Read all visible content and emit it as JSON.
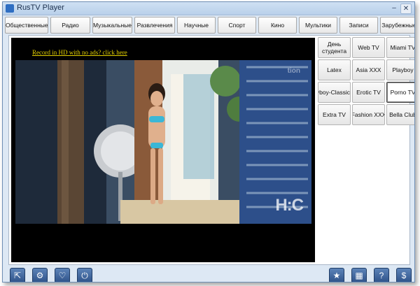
{
  "window": {
    "title": "RusTV Player",
    "close_label": "✕",
    "min_label": "–"
  },
  "tabs": [
    "Общественные",
    "Радио",
    "Музыкальные",
    "Развлечения",
    "Научные",
    "Спорт",
    "Кино",
    "Мультики",
    "Записи",
    "Зарубежные"
  ],
  "video": {
    "promo_link": "Record in HD with no ads? click here",
    "watermark_top": "tion",
    "watermark_logo": "H:C"
  },
  "channels": [
    "День студента",
    "Web TV",
    "Miami TV",
    "Latex",
    "Asia XXX",
    "Playboy",
    "Playboy-Classic",
    "Erotic TV",
    "Porno TV",
    "Extra TV",
    "Fashion XXX",
    "Bella Club"
  ],
  "selected_channel": "Porno TV",
  "bottom_buttons_left": [
    "external-link-icon",
    "gear-icon",
    "heart-icon",
    "power-icon"
  ],
  "bottom_buttons_right": [
    "star-icon",
    "grid-icon",
    "help-icon",
    "dollar-icon"
  ],
  "colors": {
    "accent": "#2e5289",
    "link": "#e6d200",
    "window_bg": "#dde8f4"
  }
}
